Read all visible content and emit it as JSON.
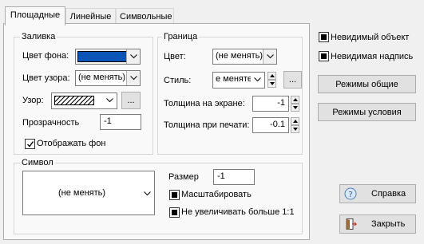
{
  "tabs": [
    "Площадные",
    "Линейные",
    "Символьные"
  ],
  "fill": {
    "title": "Заливка",
    "bg_label": "Цвет фона:",
    "bg_color": "#0a56b8",
    "pattern_color_label": "Цвет узора:",
    "pattern_color_value": "(не менять)",
    "pattern_label": "Узор:",
    "pattern_button": "...",
    "transparency_label": "Прозрачность",
    "transparency_value": "-1",
    "show_bg_label": "Отображать фон",
    "show_bg_checked": true
  },
  "border": {
    "title": "Граница",
    "color_label": "Цвет:",
    "color_value": "(не менять)",
    "style_label": "Стиль:",
    "style_value": "е меняте",
    "style_button": "...",
    "screen_width_label": "Толщина на экране:",
    "screen_width_value": "-1",
    "print_width_label": "Толщина при печати:",
    "print_width_value": "-0.1"
  },
  "symbol": {
    "title": "Символ",
    "value": "(не менять)",
    "size_label": "Размер",
    "size_value": "-1",
    "scale_label": "Масштабировать",
    "no_enlarge_label": "Не увеличивать больше 1:1"
  },
  "right": {
    "invisible_object": "Невидимый объект",
    "invisible_label": "Невидимая надпись",
    "general_modes": "Режимы общие",
    "condition_modes": "Режимы условия",
    "help": "Справка",
    "close": "Закрыть"
  }
}
